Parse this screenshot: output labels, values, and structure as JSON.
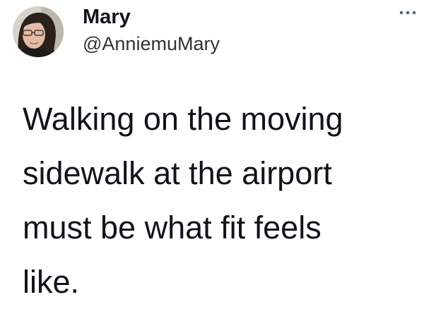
{
  "author": {
    "display_name": "Mary",
    "handle": "@AnniemuMary",
    "avatar_icon": "profile-photo"
  },
  "menu": {
    "icon": "more-horizontal-icon"
  },
  "tweet": {
    "lines": [
      "Walking on the moving",
      "sidewalk at the airport",
      "must be what fit feels",
      "like."
    ]
  },
  "colors": {
    "text": "#0f1419",
    "handle": "#2f3336",
    "background": "#ffffff"
  }
}
